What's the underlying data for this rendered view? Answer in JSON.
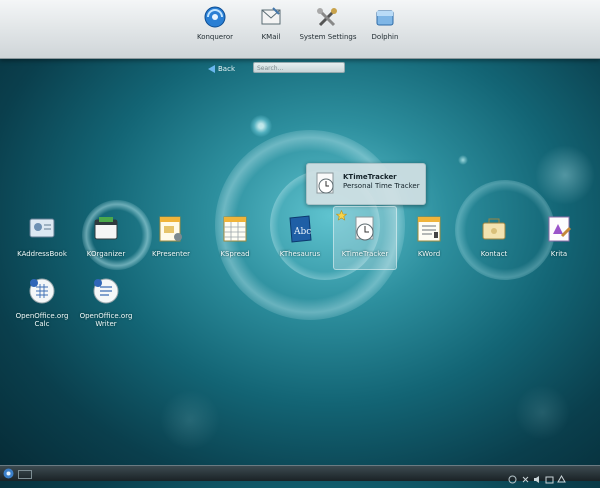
{
  "favorites": [
    {
      "label": "Konqueror",
      "icon": "konqueror-icon"
    },
    {
      "label": "KMail",
      "icon": "kmail-icon"
    },
    {
      "label": "System Settings",
      "icon": "system-settings-icon"
    },
    {
      "label": "Dolphin",
      "icon": "dolphin-icon"
    }
  ],
  "nav": {
    "back_label": "Back",
    "search_placeholder": "Search..."
  },
  "tooltip": {
    "title": "KTimeTracker",
    "subtitle": "Personal Time Tracker"
  },
  "apps": [
    {
      "label": "KAddressBook",
      "icon": "kaddressbook-icon"
    },
    {
      "label": "KOrganizer",
      "icon": "korganizer-icon"
    },
    {
      "label": "KPresenter",
      "icon": "kpresenter-icon"
    },
    {
      "label": "KSpread",
      "icon": "kspread-icon"
    },
    {
      "label": "KThesaurus",
      "icon": "kthesaurus-icon"
    },
    {
      "label": "KTimeTracker",
      "icon": "ktimetracker-icon"
    },
    {
      "label": "KWord",
      "icon": "kword-icon"
    },
    {
      "label": "Kontact",
      "icon": "kontact-icon"
    },
    {
      "label": "Krita",
      "icon": "krita-icon"
    },
    {
      "label": "OpenOffice.org Calc",
      "icon": "openoffice-calc-icon"
    },
    {
      "label": "OpenOffice.org Writer",
      "icon": "openoffice-writer-icon"
    }
  ],
  "colors": {
    "accent": "#6ab6ee",
    "background": "#136575",
    "topbar": "#dfe4e6"
  }
}
